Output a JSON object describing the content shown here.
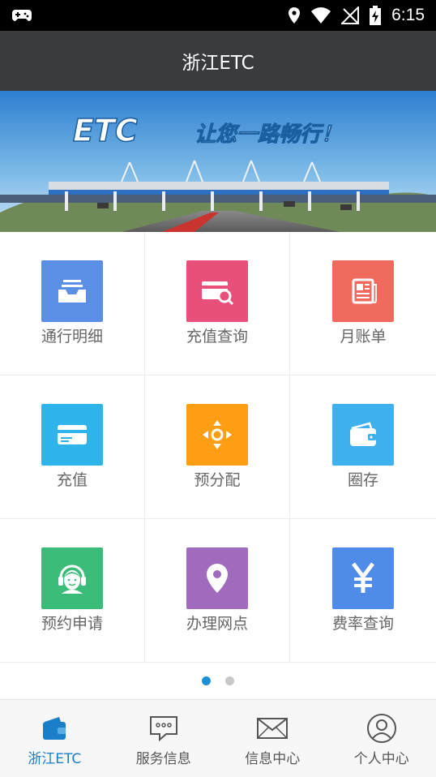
{
  "status_bar": {
    "time": "6:15"
  },
  "app_bar": {
    "title": "浙江ETC"
  },
  "banner": {
    "slogan_logo": "ETC",
    "slogan_text": "让您一路畅行！"
  },
  "grid": {
    "items": [
      {
        "label": "通行明细",
        "icon": "tray-icon",
        "color": "#5b8fe6"
      },
      {
        "label": "充值查询",
        "icon": "card-search-icon",
        "color": "#e8507a"
      },
      {
        "label": "月账单",
        "icon": "newspaper-icon",
        "color": "#f06a5d"
      },
      {
        "label": "充值",
        "icon": "credit-card-icon",
        "color": "#2eb4ea"
      },
      {
        "label": "预分配",
        "icon": "move-arrows-icon",
        "color": "#ff9e12"
      },
      {
        "label": "圈存",
        "icon": "wallet-icon",
        "color": "#3fb0ee"
      },
      {
        "label": "预约申请",
        "icon": "headset-agent-icon",
        "color": "#3cbc79"
      },
      {
        "label": "办理网点",
        "icon": "location-pin-icon",
        "color": "#a06bbd"
      },
      {
        "label": "费率查询",
        "icon": "yen-icon",
        "color": "#4f8be8"
      }
    ]
  },
  "pager": {
    "pages": 2,
    "current": 1
  },
  "tabs": [
    {
      "label": "浙江ETC",
      "icon": "etc-wallet-icon",
      "active": true
    },
    {
      "label": "服务信息",
      "icon": "chat-bubble-icon",
      "active": false
    },
    {
      "label": "信息中心",
      "icon": "envelope-icon",
      "active": false
    },
    {
      "label": "个人中心",
      "icon": "user-circle-icon",
      "active": false
    }
  ],
  "colors": {
    "app_bar": "#393b3f",
    "accent": "#1a7fc9"
  }
}
